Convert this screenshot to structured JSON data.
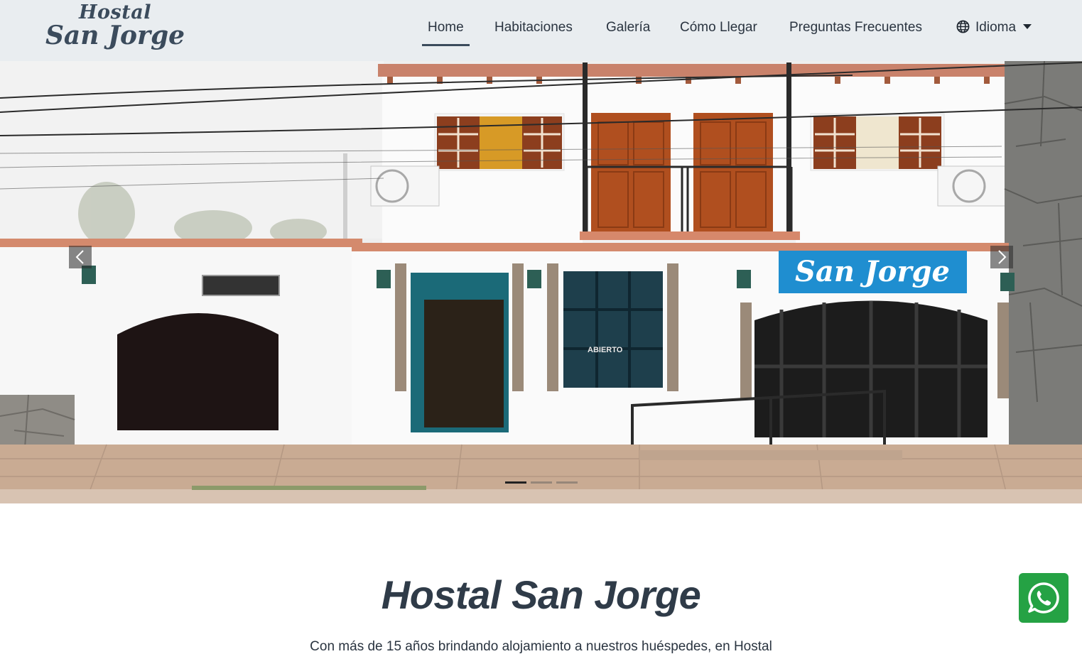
{
  "brand": {
    "line1": "Hostal",
    "line2": "San Jorge"
  },
  "nav": {
    "items": [
      {
        "label": "Home",
        "active": true
      },
      {
        "label": "Habitaciones"
      },
      {
        "label": "Galería"
      },
      {
        "label": "Cómo Llegar"
      },
      {
        "label": "Preguntas Frecuentes"
      }
    ],
    "language": {
      "label": "Idioma",
      "icon": "globe-icon"
    }
  },
  "hero": {
    "sign_text": "San Jorge",
    "door_text": "ABIERTO",
    "slides_count": 3,
    "active_slide": 1
  },
  "content": {
    "title": "Hostal San Jorge",
    "intro": "Con más de 15 años brindando alojamiento a nuestros huéspedes, en Hostal"
  },
  "colors": {
    "navbar_bg": "#e9edf0",
    "brand": "#3b4b5c",
    "whatsapp": "#25a244",
    "sign_bg": "#1f8ed0"
  }
}
